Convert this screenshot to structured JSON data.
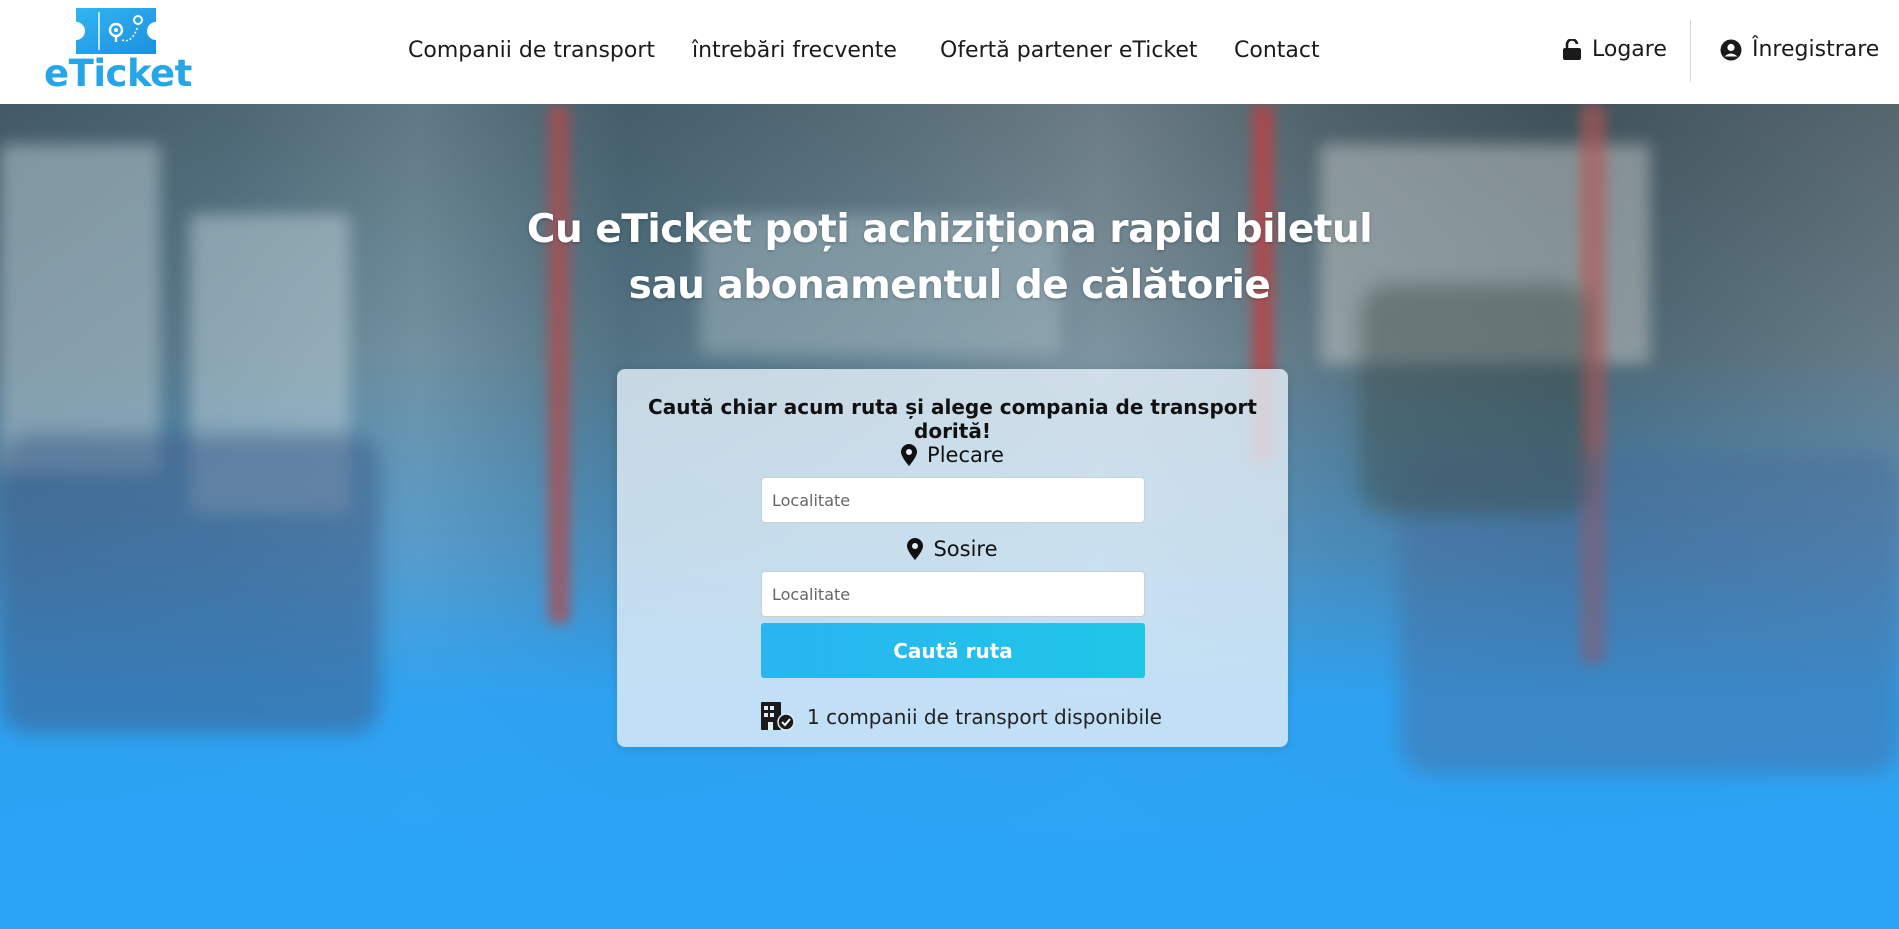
{
  "brand": {
    "logo_text": "eTicket"
  },
  "nav": {
    "items": [
      {
        "label": "Companii de transport"
      },
      {
        "label": "întrebări frecvente"
      },
      {
        "label": "Ofertă partener eTicket"
      },
      {
        "label": "Contact"
      }
    ]
  },
  "auth": {
    "login_label": "Logare",
    "register_label": "Înregistrare"
  },
  "hero": {
    "title_line1": "Cu eTicket poți achiziționa rapid biletul",
    "title_line2": "sau abonamentul de călătorie"
  },
  "search": {
    "headline": "Caută chiar acum ruta și alege compania de transport dorită!",
    "departure_label": "Plecare",
    "departure_placeholder": "Localitate",
    "departure_value": "",
    "arrival_label": "Sosire",
    "arrival_placeholder": "Localitate",
    "arrival_value": "",
    "button_label": "Caută ruta",
    "companies_text": "1 companii de transport disponibile"
  },
  "icons": {
    "pin": "map-marker-icon",
    "lock": "unlock-icon",
    "user": "user-circle-icon",
    "building": "building-check-icon"
  },
  "colors": {
    "accent": "#25a6e8",
    "button_start": "#29b4f2",
    "button_end": "#1fc7e6",
    "hero_bottom": "#2ba4f7"
  }
}
